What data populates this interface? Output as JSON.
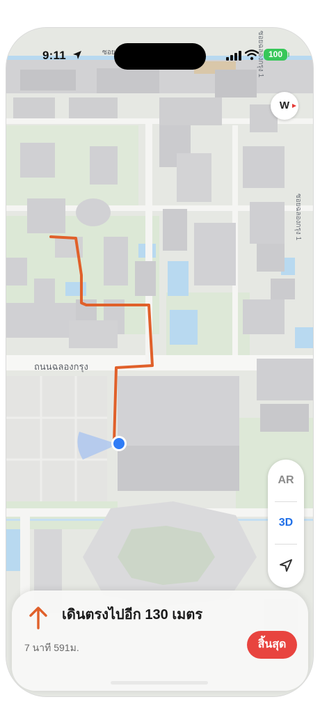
{
  "status_bar": {
    "time": "9:11",
    "battery": "100"
  },
  "map": {
    "street_label_main": "ถนนฉลองกรุง",
    "street_label_top": "ซอยฉลองกรุง 1",
    "street_label_right": "ซอยฉลองกรุง 1",
    "street_label_topleft": "ซอย",
    "route_color": "#e0602a",
    "user_dot_color": "#2f7cf6"
  },
  "compass": {
    "heading": "W"
  },
  "controls": {
    "ar_label": "AR",
    "view_3d_label": "3D",
    "locate_icon": "location-arrow-icon"
  },
  "navigation": {
    "instruction": "เดินตรงไปอีก 130 เมตร",
    "eta": "7 นาที  591ม.",
    "end_button": "สิ้นสุด",
    "direction_icon": "arrow-up-icon",
    "accent_color": "#e0602a"
  }
}
